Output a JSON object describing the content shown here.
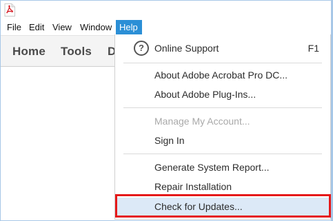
{
  "titlebar": {
    "icon": "adobe-acrobat-pdf-icon"
  },
  "menubar": {
    "items": [
      "File",
      "Edit",
      "View",
      "Window",
      "Help"
    ],
    "active": "Help"
  },
  "toolbar": {
    "tabs": [
      "Home",
      "Tools",
      "D"
    ]
  },
  "help_menu": {
    "online_support": "Online Support",
    "online_support_shortcut": "F1",
    "about_acrobat": "About Adobe Acrobat Pro DC...",
    "about_plugins": "About Adobe Plug-Ins...",
    "manage_account": "Manage My Account...",
    "sign_in": "Sign In",
    "generate_report": "Generate System Report...",
    "repair_installation": "Repair Installation",
    "check_updates": "Check for Updates..."
  },
  "colors": {
    "menu_active": "#2b8fd6",
    "highlight_box": "#e51919",
    "hover_row": "#dce9f7"
  }
}
